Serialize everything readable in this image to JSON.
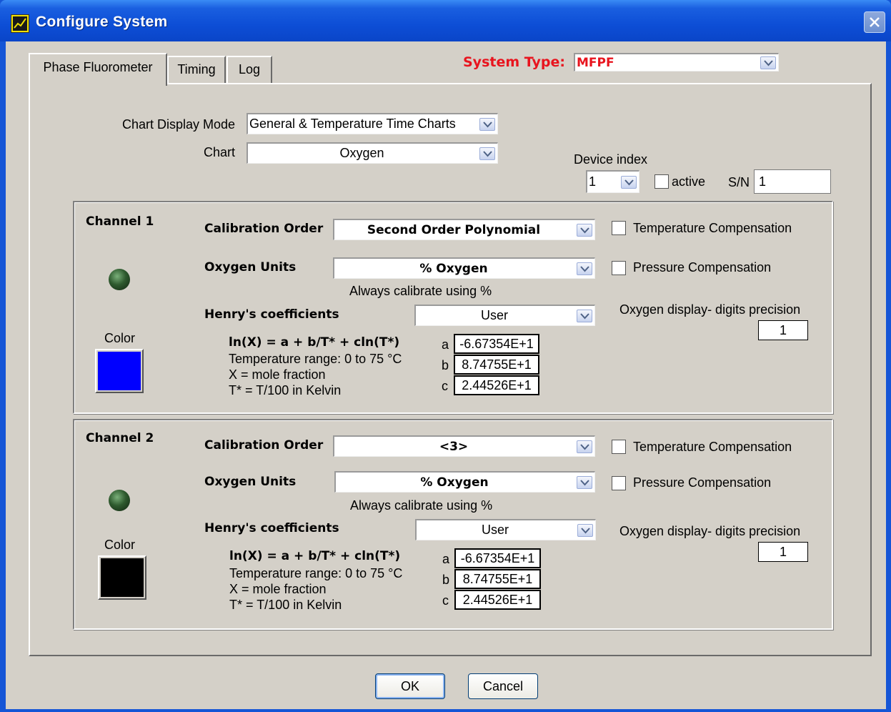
{
  "window": {
    "title": "Configure System"
  },
  "tabs": [
    "Phase Fluorometer",
    "Timing",
    "Log"
  ],
  "system_type": {
    "label": "System Type:",
    "value": "MFPF",
    "color": "#e8141e"
  },
  "chart_display_mode": {
    "label": "Chart Display Mode",
    "value": "General & Temperature Time Charts"
  },
  "chart": {
    "label": "Chart",
    "value": "Oxygen"
  },
  "device": {
    "index_label": "Device index",
    "index_value": "1",
    "active_label": "active",
    "sn_label": "S/N",
    "sn_value": "1"
  },
  "channels": [
    {
      "title": "Channel 1",
      "calibration_order_label": "Calibration Order",
      "calibration_order_value": "Second Order Polynomial",
      "oxygen_units_label": "Oxygen Units",
      "oxygen_units_value": "% Oxygen",
      "calibrate_note": "Always calibrate using %",
      "henry_label": "Henry's coefficients",
      "henry_value": "User",
      "temp_comp_label": "Temperature Compensation",
      "pressure_comp_label": "Pressure Compensation",
      "precision_label": "Oxygen display- digits precision",
      "precision_value": "1",
      "color_label": "Color",
      "color": "#0000ff",
      "formula": "ln(X) = a + b/T* + cln(T*)",
      "temp_range": "Temperature range: 0 to 75 °C",
      "x_def": "X = mole fraction",
      "t_def": "T* = T/100 in Kelvin",
      "coef": {
        "a_label": "a",
        "a": "-6.67354E+1",
        "b_label": "b",
        "b": "8.74755E+1",
        "c_label": "c",
        "c": "2.44526E+1"
      }
    },
    {
      "title": "Channel 2",
      "calibration_order_label": "Calibration Order",
      "calibration_order_value": "<3>",
      "oxygen_units_label": "Oxygen Units",
      "oxygen_units_value": "% Oxygen",
      "calibrate_note": "Always calibrate using %",
      "henry_label": "Henry's coefficients",
      "henry_value": "User",
      "temp_comp_label": "Temperature Compensation",
      "pressure_comp_label": "Pressure Compensation",
      "precision_label": "Oxygen display- digits precision",
      "precision_value": "1",
      "color_label": "Color",
      "color": "#000000",
      "formula": "ln(X) = a + b/T* + cln(T*)",
      "temp_range": "Temperature range: 0 to 75 °C",
      "x_def": "X = mole fraction",
      "t_def": "T* = T/100 in Kelvin",
      "coef": {
        "a_label": "a",
        "a": "-6.67354E+1",
        "b_label": "b",
        "b": "8.74755E+1",
        "c_label": "c",
        "c": "2.44526E+1"
      }
    }
  ],
  "buttons": {
    "ok": "OK",
    "cancel": "Cancel"
  }
}
